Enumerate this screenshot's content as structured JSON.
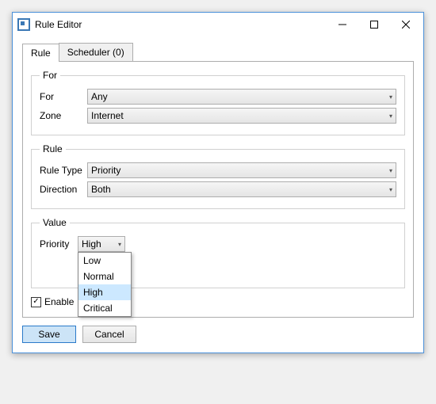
{
  "window": {
    "title": "Rule Editor"
  },
  "tabs": {
    "rule": "Rule",
    "scheduler": "Scheduler (0)"
  },
  "groups": {
    "for": "For",
    "rule": "Rule",
    "value": "Value"
  },
  "labels": {
    "for": "For",
    "zone": "Zone",
    "ruleType": "Rule Type",
    "direction": "Direction",
    "priority": "Priority",
    "enable": "Enable"
  },
  "values": {
    "for": "Any",
    "zone": "Internet",
    "ruleType": "Priority",
    "direction": "Both",
    "priority": "High"
  },
  "priorityOptions": {
    "0": "Low",
    "1": "Normal",
    "2": "High",
    "3": "Critical"
  },
  "buttons": {
    "save": "Save",
    "cancel": "Cancel"
  },
  "checkbox": {
    "enableChecked": "✓"
  }
}
